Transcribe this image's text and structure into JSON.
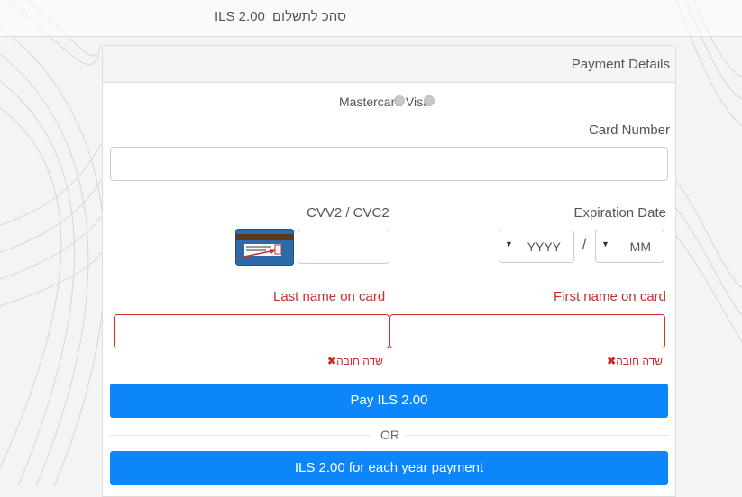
{
  "summary": {
    "total_label": "סהכ לתשלום",
    "total_amount": "ILS 2.00"
  },
  "panel": {
    "title": "Payment Details"
  },
  "card_types": {
    "text": "Mastercard Visa",
    "options": [
      "Mastercard",
      "Visa"
    ]
  },
  "card_number": {
    "label": "Card Number",
    "value": ""
  },
  "expiration": {
    "label": "Expiration Date",
    "month_placeholder": "MM",
    "year_placeholder": "YYYY",
    "separator": "/"
  },
  "cvv": {
    "label": "CVV2 / CVC2",
    "value": ""
  },
  "first_name": {
    "label": "First name on card",
    "value": "",
    "error": "שדה חובה"
  },
  "last_name": {
    "label": "Last name on card",
    "value": "",
    "error": "שדה חובה"
  },
  "actions": {
    "pay_label": "Pay ILS 2.00",
    "or_label": "OR",
    "recurring_label": "ILS 2.00 for each year payment"
  },
  "colors": {
    "primary_button": "#0d85fb",
    "error": "#c9302c",
    "border": "#cccccc"
  }
}
